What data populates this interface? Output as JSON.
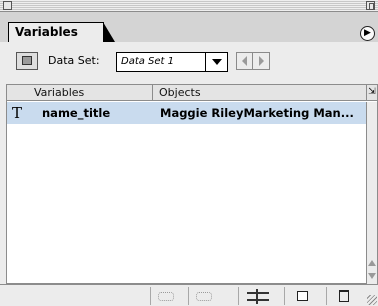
{
  "panel": {
    "tab_label": "Variables",
    "menu_icon": "play-circle-icon"
  },
  "toolbar": {
    "dataset_label": "Data Set:",
    "dataset_value": "Data Set 1",
    "capture_icon": "capture-dataset-icon",
    "prev_icon": "previous-dataset-icon",
    "next_icon": "next-dataset-icon"
  },
  "table": {
    "columns": [
      "Variables",
      "Objects"
    ],
    "rows": [
      {
        "type_icon": "T",
        "variable": "name_title",
        "object": "Maggie RileyMarketing Man..."
      }
    ],
    "selected_row_color": "#c9dbee"
  },
  "bottom_toolbar": {
    "icons": [
      "make-visibility-dynamic-icon",
      "make-object-dynamic-icon",
      "unbind-variable-icon",
      "new-variable-icon",
      "delete-variable-icon"
    ]
  }
}
